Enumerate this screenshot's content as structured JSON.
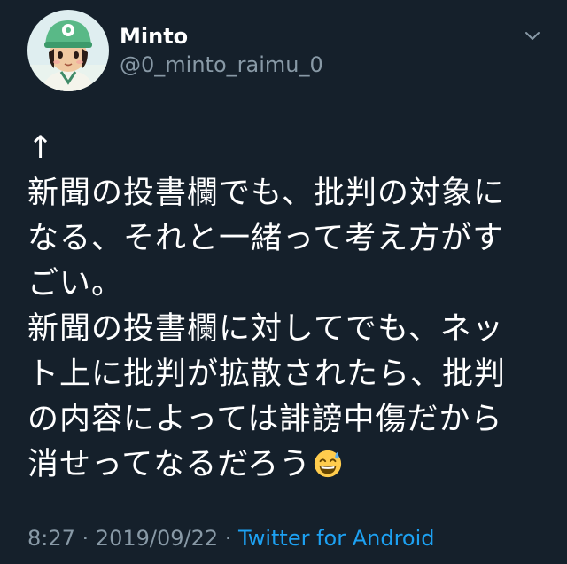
{
  "author": {
    "display_name": "Minto",
    "handle": "@0_minto_raimu_0",
    "avatar_icon": "villager-avatar-icon"
  },
  "menu": {
    "icon": "chevron-down-icon"
  },
  "tweet": {
    "lines": [
      "↑",
      "新聞の投書欄でも、批判の対象に",
      "なる、それと一緒って考え方がす",
      "ごい。",
      "新聞の投書欄に対してでも、ネッ",
      "ト上に批判が拡散されたら、批判",
      "の内容によっては誹謗中傷だから",
      "消せってなるだろう"
    ],
    "emoji": "grinning-face-with-sweat-emoji"
  },
  "meta": {
    "time": "8:27",
    "separator1": " · ",
    "date": "2019/09/22",
    "separator2": " · ",
    "source": "Twitter for Android"
  },
  "colors": {
    "background": "#15202b",
    "text": "#ffffff",
    "secondary": "#8899a6",
    "link": "#1da1f2"
  }
}
